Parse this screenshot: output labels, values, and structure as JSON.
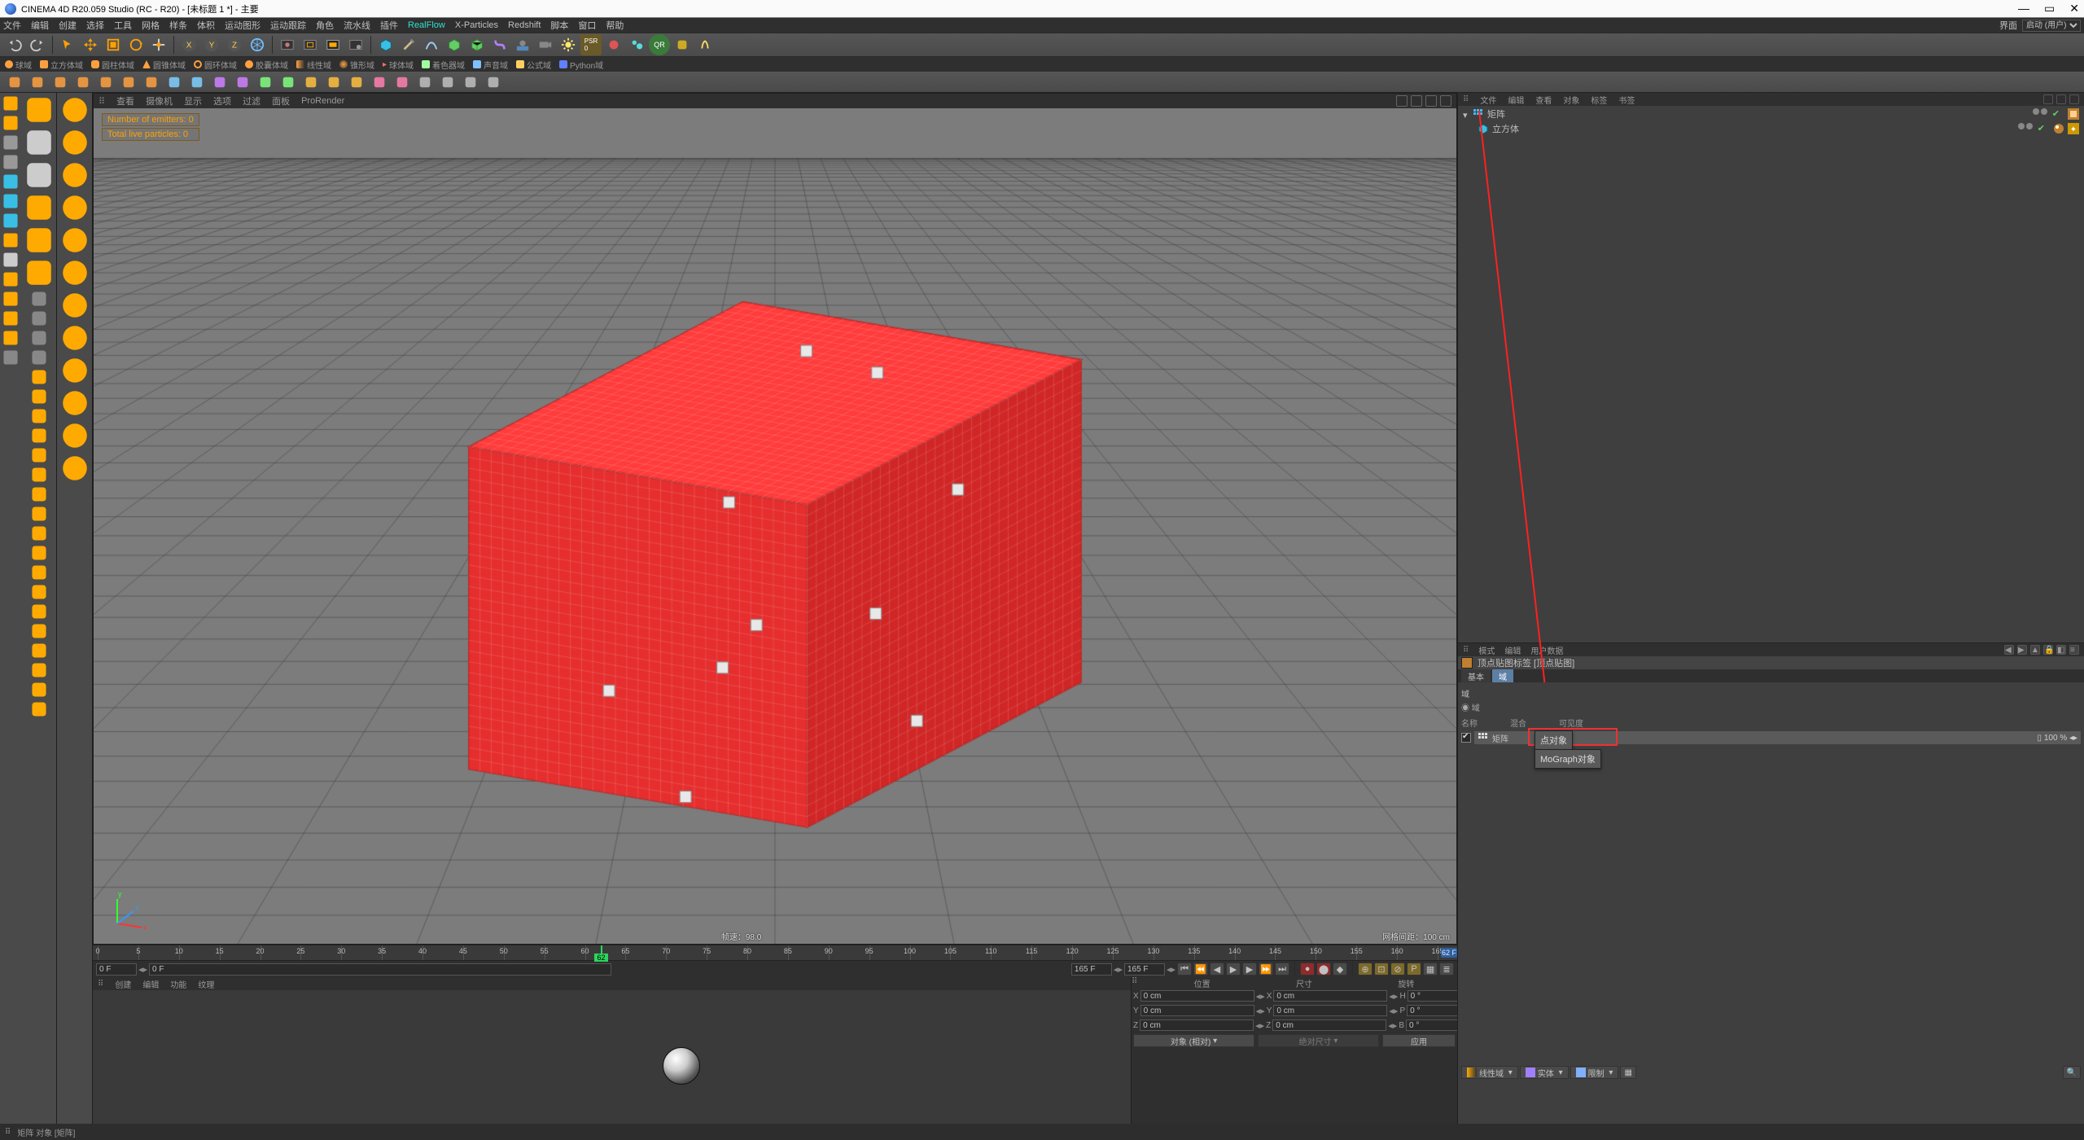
{
  "title": "CINEMA 4D R20.059 Studio (RC - R20) - [未标题 1 *] - 主要",
  "menu": [
    "文件",
    "编辑",
    "创建",
    "选择",
    "工具",
    "网格",
    "样条",
    "体积",
    "运动图形",
    "运动跟踪",
    "角色",
    "流水线",
    "插件",
    "RealFlow",
    "X-Particles",
    "Redshift",
    "脚本",
    "窗口",
    "帮助"
  ],
  "layout_label": "界面",
  "layout_value": "启动 (用户)",
  "fields_shelf": [
    "球域",
    "立方体域",
    "圆柱体域",
    "圆锥体域",
    "圆环体域",
    "胶囊体域",
    "线性域",
    "锥形域",
    "球体域",
    "着色器域",
    "声音域",
    "公式域",
    "Python域"
  ],
  "vp_menu": [
    "查看",
    "摄像机",
    "显示",
    "选项",
    "过滤",
    "面板",
    "ProRender"
  ],
  "overlay": {
    "emitters": "Number of emitters: 0",
    "particles": "Total live particles: 0"
  },
  "vp_footer": {
    "focal": "帧速：98.0",
    "grid": "网格间距：100 cm"
  },
  "timeline": {
    "start": 0,
    "end": 165,
    "cur": 62,
    "marks": [
      0,
      5,
      10,
      15,
      20,
      25,
      30,
      35,
      40,
      45,
      50,
      55,
      60,
      65,
      70,
      75,
      80,
      85,
      90,
      95,
      100,
      105,
      110,
      115,
      120,
      125,
      130,
      135,
      140,
      145,
      150,
      155,
      160,
      165
    ],
    "bluebar": "62 F",
    "field_start": "0 F",
    "field_cur": "0 F",
    "field_end": "165 F",
    "field_end2": "165 F"
  },
  "mat_menu": [
    "创建",
    "编辑",
    "功能",
    "纹理"
  ],
  "coord": {
    "headers": [
      "位置",
      "尺寸",
      "旋转"
    ],
    "X": {
      "pos": "0 cm",
      "size": "0 cm",
      "rot": "0 °"
    },
    "Y": {
      "pos": "0 cm",
      "size": "0 cm",
      "rot": "0 °"
    },
    "Z": {
      "pos": "0 cm",
      "size": "0 cm",
      "rot": "0 °"
    },
    "btn1": "对象 (相对)",
    "btn2": "绝对尺寸",
    "apply": "应用"
  },
  "om": {
    "tabs": [
      "文件",
      "编辑",
      "查看",
      "对象",
      "标签",
      "书签"
    ],
    "rows": [
      {
        "name": "矩阵",
        "type": "matrix",
        "depth": 0,
        "tag": "vmap"
      },
      {
        "name": "立方体",
        "type": "cube",
        "depth": 1,
        "tag": "phong"
      }
    ]
  },
  "am": {
    "tabs": [
      "模式",
      "编辑",
      "用户数据"
    ],
    "title": "顶点贴图标签 [顶点贴图]",
    "tabrow": [
      "基本",
      "域"
    ],
    "active_tab": 1,
    "group": "域",
    "subgroup": "域",
    "cols": [
      "名称",
      "混合",
      "可见度"
    ],
    "row": {
      "label": "矩阵"
    },
    "popup": [
      "点对象",
      "MoGraph对象"
    ],
    "btnbar": [
      "线性域",
      "实体",
      "限制"
    ]
  },
  "status": "矩阵 对象 [矩阵]"
}
